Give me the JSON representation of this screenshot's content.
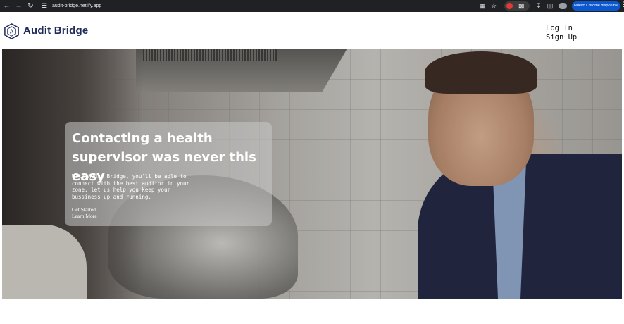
{
  "browser": {
    "url": "audit-bridge.netlify.app",
    "update_label": "Nuevo Chrome disponible",
    "icons": [
      "back-arrow-icon",
      "forward-arrow-icon",
      "reload-icon",
      "site-info-icon",
      "translate-icon",
      "bookmark-star-icon",
      "extension-icon",
      "puzzle-icon",
      "download-icon",
      "sidepanel-icon",
      "profile-icon",
      "kebab-menu-icon"
    ]
  },
  "site": {
    "brand": "Audit Bridge",
    "nav": {
      "login": "Log In",
      "signup": "Sign Up"
    }
  },
  "hero": {
    "title": "Contacting a health supervisor was never this easy",
    "description": "With Audit Bridge, you'll be able to connect with the best auditor in your zone, let us help you keep your bussiness up and running.",
    "cta_primary": "Get Started",
    "cta_secondary": "Learn More"
  },
  "colors": {
    "brand": "#1e2a5a",
    "chrome_bg": "#202124",
    "update_pill": "#0b57d0"
  }
}
